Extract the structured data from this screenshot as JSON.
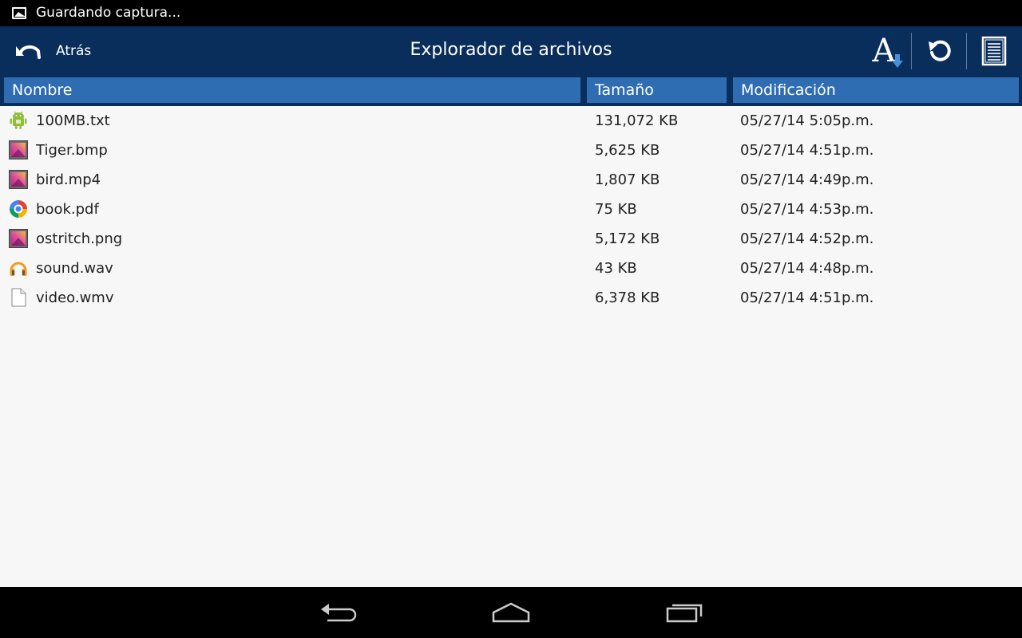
{
  "status_bar": {
    "icon": "image-icon",
    "text": "Guardando captura..."
  },
  "action_bar": {
    "back_label": "Atrás",
    "title": "Explorador de archivos",
    "buttons": [
      "font-size-icon",
      "refresh-icon",
      "list-view-icon"
    ]
  },
  "table": {
    "columns": [
      "Nombre",
      "Tamaño",
      "Modificación"
    ],
    "rows": [
      {
        "icon": "android-icon",
        "name": "100MB.txt",
        "size": "131,072 KB",
        "modified": "05/27/14 5:05p.m."
      },
      {
        "icon": "image-file-icon",
        "name": "Tiger.bmp",
        "size": "5,625 KB",
        "modified": "05/27/14 4:51p.m."
      },
      {
        "icon": "image-file-icon",
        "name": "bird.mp4",
        "size": "1,807 KB",
        "modified": "05/27/14 4:49p.m."
      },
      {
        "icon": "pdf-viewer-icon",
        "name": "book.pdf",
        "size": "75 KB",
        "modified": "05/27/14 4:53p.m."
      },
      {
        "icon": "image-file-icon",
        "name": "ostritch.png",
        "size": "5,172 KB",
        "modified": "05/27/14 4:52p.m."
      },
      {
        "icon": "headphones-icon",
        "name": "sound.wav",
        "size": "43 KB",
        "modified": "05/27/14 4:48p.m."
      },
      {
        "icon": "blank-file-icon",
        "name": "video.wmv",
        "size": "6,378 KB",
        "modified": "05/27/14 4:51p.m."
      }
    ]
  },
  "nav_bar": {
    "buttons": [
      "back-nav-icon",
      "home-icon",
      "recent-apps-icon"
    ]
  },
  "colors": {
    "action_bar": "#0a2e5c",
    "column_header": "#2f6db3",
    "content_bg": "#f7f7f7"
  }
}
